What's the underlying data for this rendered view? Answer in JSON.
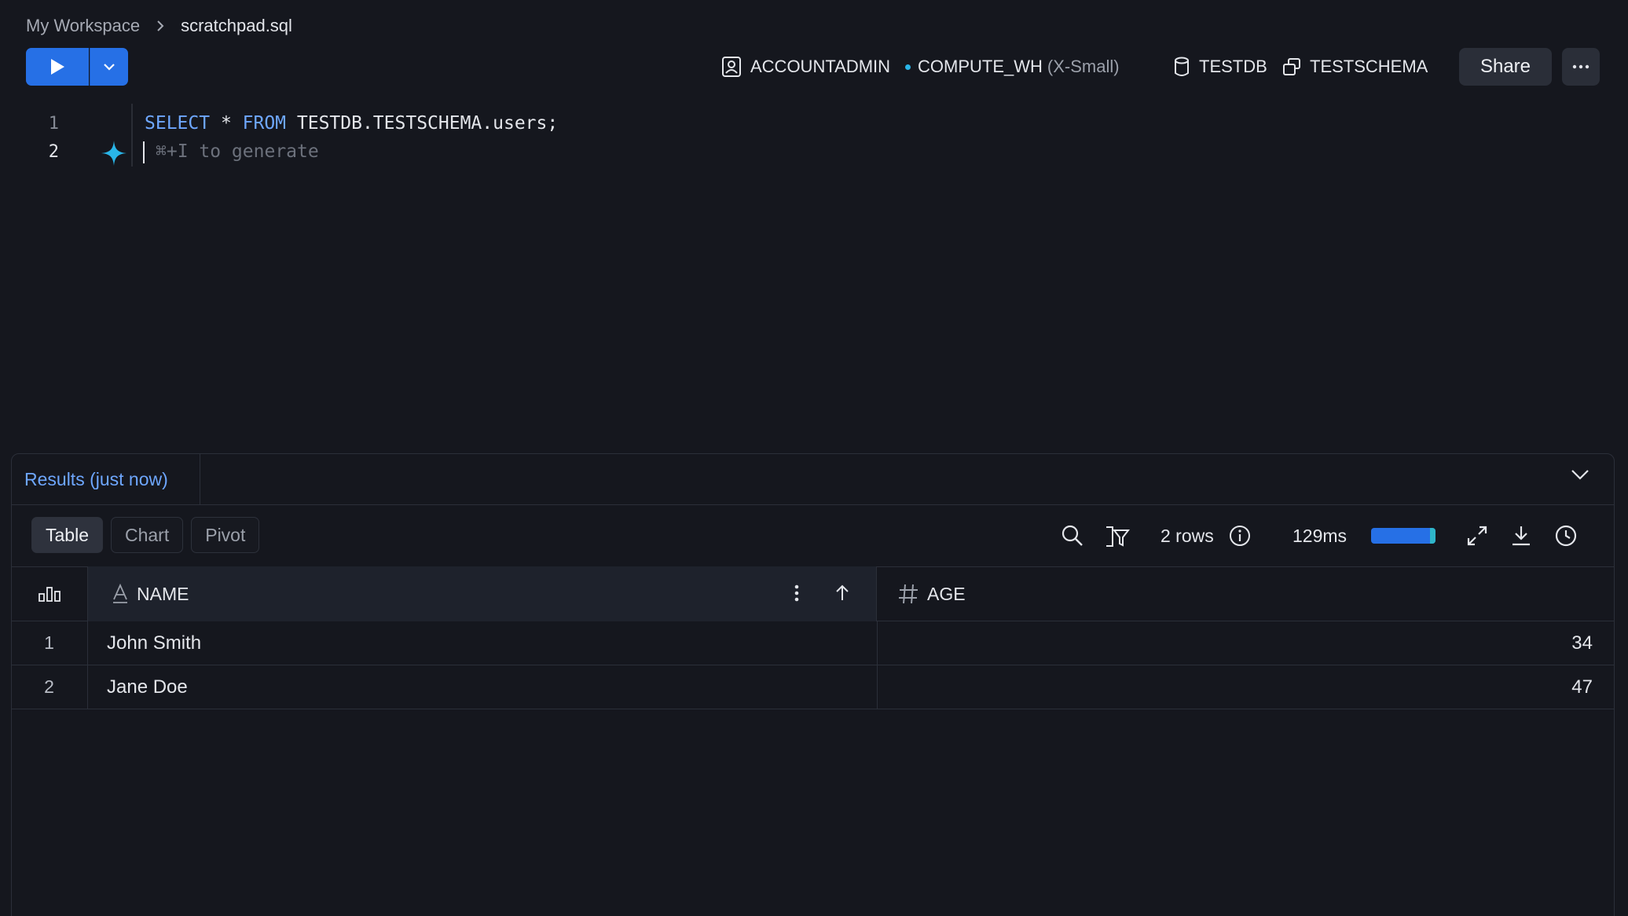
{
  "breadcrumb": {
    "workspace": "My Workspace",
    "file": "scratchpad.sql"
  },
  "context": {
    "role": "ACCOUNTADMIN",
    "warehouse": "COMPUTE_WH",
    "warehouse_size": "(X-Small)",
    "database": "TESTDB",
    "schema": "TESTSCHEMA"
  },
  "toolbar": {
    "share_label": "Share"
  },
  "editor": {
    "line_numbers": [
      "1",
      "2"
    ],
    "line1": {
      "kw_select": "SELECT",
      "star": " * ",
      "kw_from": "FROM",
      "rest": " TESTDB.TESTSCHEMA.users;"
    },
    "placeholder": "⌘+I to generate"
  },
  "results": {
    "tab_label": "Results (just now)",
    "view_tabs": [
      "Table",
      "Chart",
      "Pivot"
    ],
    "active_view": "Table",
    "row_count": "2 rows",
    "timing": "129ms",
    "timing_progress": 1.0,
    "columns": [
      {
        "name": "NAME",
        "type_icon": "text-type-icon"
      },
      {
        "name": "AGE",
        "type_icon": "number-type-icon"
      }
    ],
    "rows": [
      {
        "index": "1",
        "name": "John Smith",
        "age": "34"
      },
      {
        "index": "2",
        "name": "Jane Doe",
        "age": "47"
      }
    ]
  },
  "colors": {
    "background": "#15171e",
    "accent": "#2670e6",
    "link": "#6ea7ff",
    "warehouse_status": "#29b5e8"
  }
}
